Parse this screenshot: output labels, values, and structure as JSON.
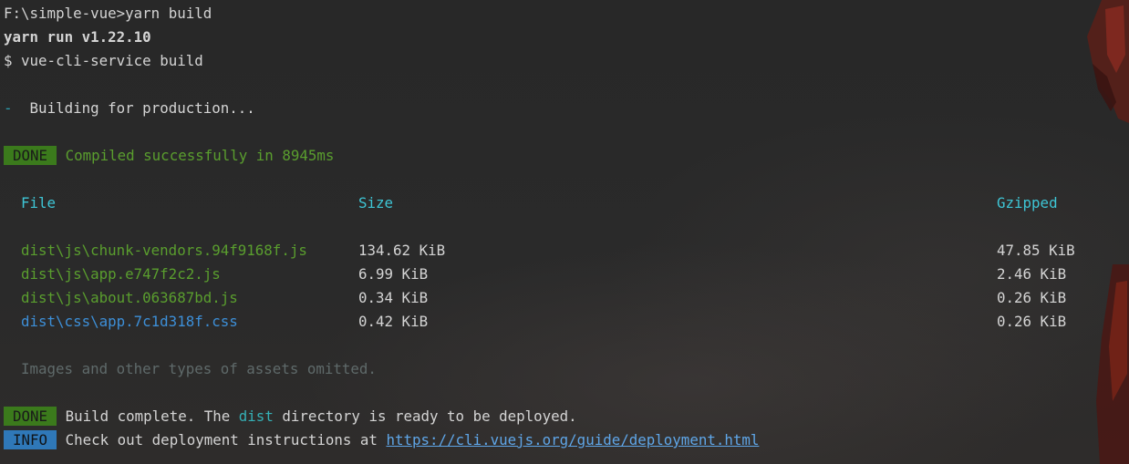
{
  "terminal": {
    "prompt_line": "F:\\simple-vue>yarn build",
    "yarn_version": "yarn run v1.22.10",
    "command": "$ vue-cli-service build",
    "spinner": "-",
    "building": "Building for production...",
    "done_tag": "DONE",
    "compiled": "Compiled successfully in 8945ms",
    "table": {
      "headers": {
        "file": "File",
        "size": "Size",
        "gzipped": "Gzipped"
      },
      "rows": [
        {
          "file": "dist\\js\\chunk-vendors.94f9168f.js",
          "size": "134.62 KiB",
          "gzipped": "47.85 KiB",
          "kind": "js"
        },
        {
          "file": "dist\\js\\app.e747f2c2.js",
          "size": "6.99 KiB",
          "gzipped": "2.46 KiB",
          "kind": "js"
        },
        {
          "file": "dist\\js\\about.063687bd.js",
          "size": "0.34 KiB",
          "gzipped": "0.26 KiB",
          "kind": "js"
        },
        {
          "file": "dist\\css\\app.7c1d318f.css",
          "size": "0.42 KiB",
          "gzipped": "0.26 KiB",
          "kind": "css"
        }
      ]
    },
    "omitted_note": "Images and other types of assets omitted.",
    "build_complete": {
      "tag": "DONE",
      "before": "Build complete. The ",
      "highlight": "dist",
      "after": " directory is ready to be deployed."
    },
    "info": {
      "tag": "INFO",
      "text": "Check out deployment instructions at ",
      "link": "https://cli.vuejs.org/guide/deployment.html"
    }
  },
  "colors": {
    "background": "#2b2b2b",
    "text": "#d4d4d4",
    "success_green": "#5a9e2e",
    "css_blue": "#3d8fd8",
    "header_cyan": "#3ec6d6",
    "done_tag_bg": "#3b7a1c",
    "info_tag_bg": "#2f78b8"
  }
}
